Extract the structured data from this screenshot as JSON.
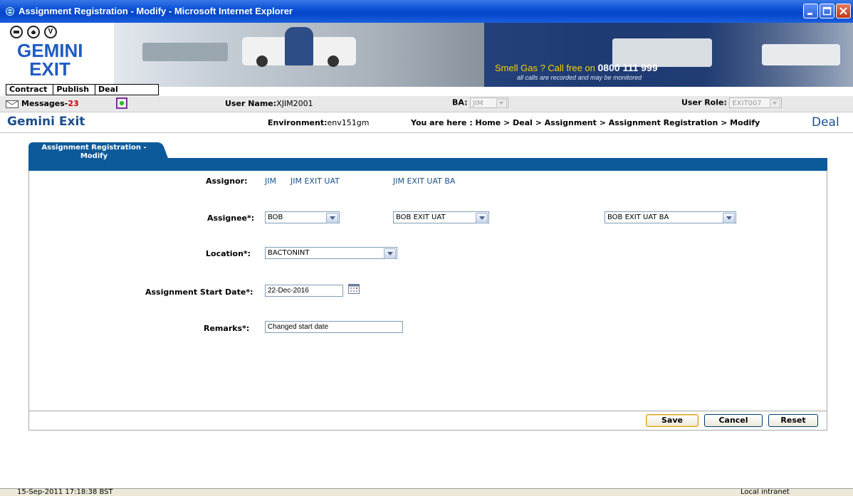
{
  "window": {
    "title": "Assignment Registration - Modify - Microsoft Internet Explorer"
  },
  "header": {
    "circle_buttons": [
      "",
      "",
      "V"
    ],
    "logo_line1": "GEMINI",
    "logo_line2": "EXIT",
    "banner_text": "Smell Gas ? Call free on ",
    "banner_number": "0800 111 999",
    "banner_subtext": "all calls are recorded and may be monitored"
  },
  "menu": {
    "items": [
      "Contract",
      "Publish",
      "Deal"
    ]
  },
  "infobar": {
    "messages_label": "Messages-",
    "messages_count": "23",
    "user_name_label": "User Name:",
    "user_name": "XJIM2001",
    "ba_label": "BA:",
    "ba_value": "JIM",
    "user_role_label": "User Role:",
    "user_role_value": "EXIT007"
  },
  "crumbrow": {
    "page_title": "Gemini Exit",
    "environment_label": "Environment:",
    "environment": "env151gm",
    "breadcrumb": "You are here : Home > Deal > Assignment > Assignment Registration > Modify",
    "section": "Deal"
  },
  "panel": {
    "tab_line1": "Assignment Registration -",
    "tab_line2": "Modify"
  },
  "form": {
    "assignor_label": "Assignor:",
    "assignor_code": "JIM",
    "assignor_name": "JIM EXIT UAT",
    "assignor_ba": "JIM EXIT UAT BA",
    "assignee_label": "Assignee*:",
    "assignee_code": "BOB",
    "assignee_name": "BOB EXIT UAT",
    "assignee_ba": "BOB EXIT UAT BA",
    "location_label": "Location*:",
    "location_value": "BACTONINT",
    "start_date_label": "Assignment Start Date*:",
    "start_date_value": "22-Dec-2016",
    "remarks_label": "Remarks*:",
    "remarks_value": "Changed start date"
  },
  "buttons": {
    "save": "Save",
    "cancel": "Cancel",
    "reset": "Reset"
  },
  "statusbar": {
    "left_text": "15-Sep-2011  17:18:38 BST",
    "zone_text": "Local intranet"
  },
  "colors": {
    "titlebar": "#0a4fd6",
    "panel_header": "#0c5a9a",
    "brand_text": "#1c4f8c",
    "logo": "#1f5bc4",
    "message_count": "#cc0000",
    "banner_yellow": "#f7d200"
  }
}
